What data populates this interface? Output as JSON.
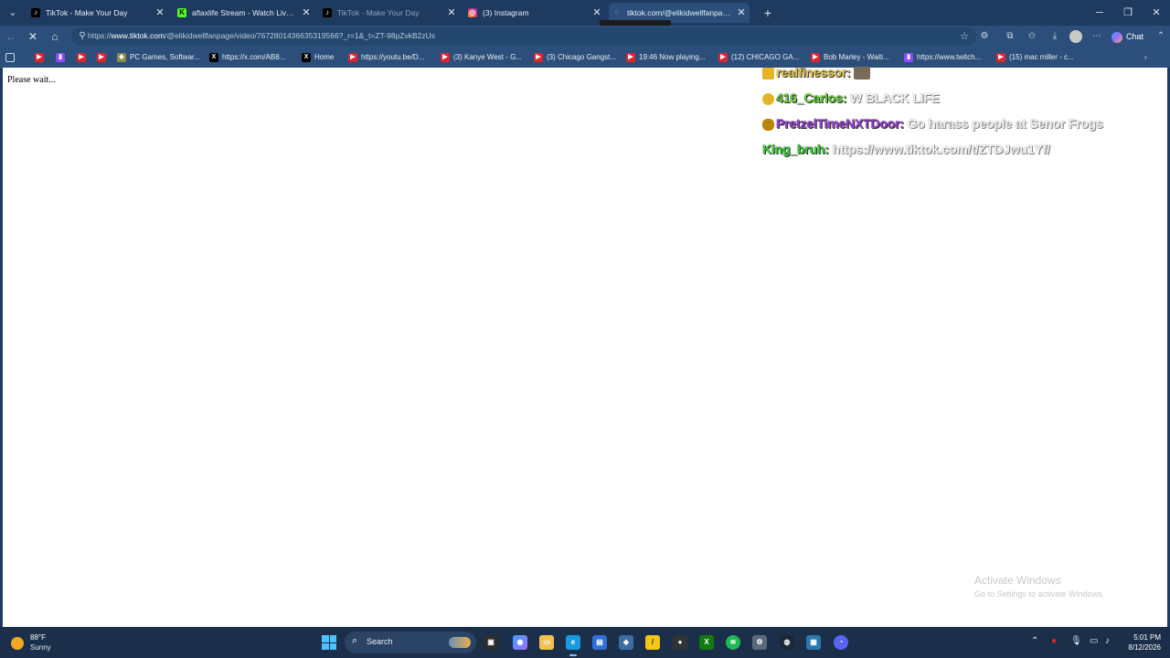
{
  "browser": {
    "tabs": [
      {
        "title": "TikTok - Make Your Day",
        "icon": "tiktok-icon"
      },
      {
        "title": "aflaxlife Stream - Watch Live on Kick",
        "icon": "kick-icon"
      },
      {
        "title": "TikTok - Make Your Day",
        "icon": "tiktok-icon"
      },
      {
        "title": "(3) Instagram",
        "icon": "instagram-icon"
      },
      {
        "title": "tiktok.com/@elikidwellfanpage/video",
        "icon": "loading-icon"
      }
    ],
    "url_protocol": "https://",
    "url_host": "www.tiktok.com",
    "url_rest": "/@elikidwellfanpage/video/7672801436635319566?_r=1&_t=ZT-98pZvkB2zUs",
    "chat_label": "Chat",
    "bookmarks": [
      {
        "label": "",
        "icon": "youtube-icon"
      },
      {
        "label": "",
        "icon": "twitch-icon"
      },
      {
        "label": "",
        "icon": "youtube-icon"
      },
      {
        "label": "",
        "icon": "youtube-icon"
      },
      {
        "label": "PC Games, Softwar...",
        "icon": "games-icon"
      },
      {
        "label": "https://x.com/AB8...",
        "icon": "x-icon"
      },
      {
        "label": "Home",
        "icon": "x-icon"
      },
      {
        "label": "https://youtu.be/D...",
        "icon": "youtube-icon"
      },
      {
        "label": "(3) Kanye West - G...",
        "icon": "youtube-icon"
      },
      {
        "label": "(3) Chicago Gangst...",
        "icon": "youtube-icon"
      },
      {
        "label": "19:46 Now playing...",
        "icon": "youtube-icon"
      },
      {
        "label": "(12) CHICAGO GA...",
        "icon": "youtube-icon"
      },
      {
        "label": "Bob Marley - Waiti...",
        "icon": "youtube-icon"
      },
      {
        "label": "https://www.twitch...",
        "icon": "twitch-icon"
      },
      {
        "label": "(15) mac miller - c...",
        "icon": "youtube-icon"
      }
    ]
  },
  "page": {
    "status_text": "Please wait..."
  },
  "overlay_chat": [
    {
      "user": "realfinessor:",
      "message": "",
      "color": "#e6c84a"
    },
    {
      "user": "416_Carlos:",
      "message": "W BLACK LIFE",
      "color": "#63d13c"
    },
    {
      "user": "PretzelTimeNXTDoor:",
      "message": "Go harass people at Senor Frogs",
      "color": "#9b3fd6"
    },
    {
      "user": "King_bruh:",
      "message": "https://www.tiktok.com/t/ZTDJwu1Yf/",
      "color": "#3ed13c"
    }
  ],
  "watermark": {
    "line1": "Activate Windows",
    "line2": "Go to Settings to activate Windows."
  },
  "taskbar": {
    "weather_temp": "88°F",
    "weather_cond": "Sunny",
    "search_label": "Search",
    "time": "5:01 PM",
    "date": "8/12/2026"
  }
}
